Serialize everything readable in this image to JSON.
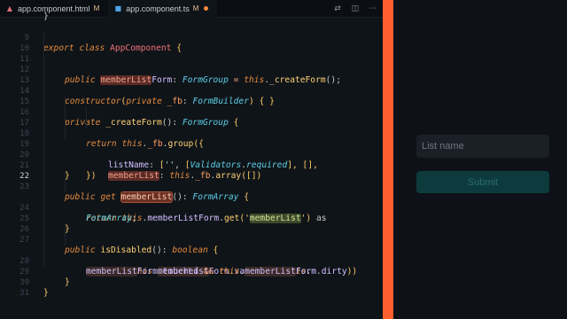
{
  "tabs": [
    {
      "label": "app.component.html",
      "status": "M",
      "icon": "angular-html-icon"
    },
    {
      "label": "app.component.ts",
      "status": "M",
      "icon": "typescript-icon",
      "unsaved": true
    }
  ],
  "editor": {
    "current_line": "22",
    "lines": [
      {
        "n": "9"
      },
      {
        "n": "10"
      },
      {
        "n": "11"
      },
      {
        "n": "12"
      },
      {
        "n": "13"
      },
      {
        "n": "14"
      },
      {
        "n": "15"
      },
      {
        "n": "16"
      },
      {
        "n": "17"
      },
      {
        "n": "18"
      },
      {
        "n": "19"
      },
      {
        "n": "20"
      },
      {
        "n": "21"
      },
      {
        "n": "22"
      },
      {
        "n": "23"
      },
      {
        "n": "24"
      },
      {
        "n": "25"
      },
      {
        "n": "26"
      },
      {
        "n": "27"
      },
      {
        "n": "28"
      },
      {
        "n": "29"
      },
      {
        "n": "30"
      },
      {
        "n": "31"
      }
    ],
    "code": {
      "l8": "}",
      "l9": {
        "kw1": "export",
        "kw2": "class",
        "name": "AppComponent",
        "brace": "{"
      },
      "l11": {
        "kw": "public",
        "prop": "memberList",
        "prop2": "Form",
        "type": "FormGroup",
        "eq": "=",
        "this": "this",
        "call": "_createForm",
        "tail": "();"
      },
      "l13": {
        "fn": "constructor",
        "paren": "(",
        "kw": "private",
        "param": "_fb",
        "colon": ":",
        "type": "FormBuilder",
        "tail": ") { }"
      },
      "l15": {
        "kw": "private",
        "fn": "_createForm",
        "paren": "():",
        "type": "FormGroup",
        "brace": "{"
      },
      "l16": {
        "kw": "return",
        "this": "this",
        "dot": ".",
        "prop": "_fb",
        "call": "group",
        "tail": "({"
      },
      "l17": {
        "key": "listName",
        "colon": ":",
        "open": "[",
        "str": "''",
        "comma": ",",
        "cls": "Validators",
        "dot": ".",
        "method": "required",
        "tail": "], [],"
      },
      "l18": {
        "key": "memberList",
        "colon": ":",
        "this": "this",
        "prop": "_fb",
        "call": "array",
        "tail": "([])"
      },
      "l19": "})",
      "l20": "}",
      "l22": {
        "kw1": "public",
        "kw2": "get",
        "name": "memberList",
        "paren": "():",
        "type": "FormArray",
        "brace": "{"
      },
      "l23": {
        "kw": "return",
        "this": "this",
        "prop": "memberListForm",
        "call": "get",
        "open": "('",
        "str": "memberList",
        "close": "')",
        "as": "as"
      },
      "l23b": {
        "type": "FormArray",
        "tail": ";"
      },
      "l24": "}",
      "l26": {
        "kw": "public",
        "fn": "isDisabled",
        "paren": "():",
        "type": "boolean",
        "brace": "{"
      },
      "l27": {
        "kw": "return",
        "bang": "!(",
        "this": "this",
        "prop1": "memberList",
        "prop2": "Form",
        "prop3": "valid",
        "op": "&&",
        "open": "(",
        "this2": "this",
        "dot": "."
      },
      "l27b": {
        "prop1": "memberList",
        "prop2": "Form",
        "prop3": "touched",
        "op": "&&",
        "this": "this",
        "prop4": "memberList",
        "prop5": "Form",
        "prop6": "dirty",
        "tail": "))"
      },
      "l28": "}",
      "l30": "}"
    }
  },
  "preview": {
    "list_name_placeholder": "List name",
    "submit_label": "Submit"
  },
  "colors": {
    "divider": "#ff5e2f",
    "submit_bg": "#0d3b3d",
    "keyword": "#e58b3c",
    "type": "#5ccfe6"
  }
}
